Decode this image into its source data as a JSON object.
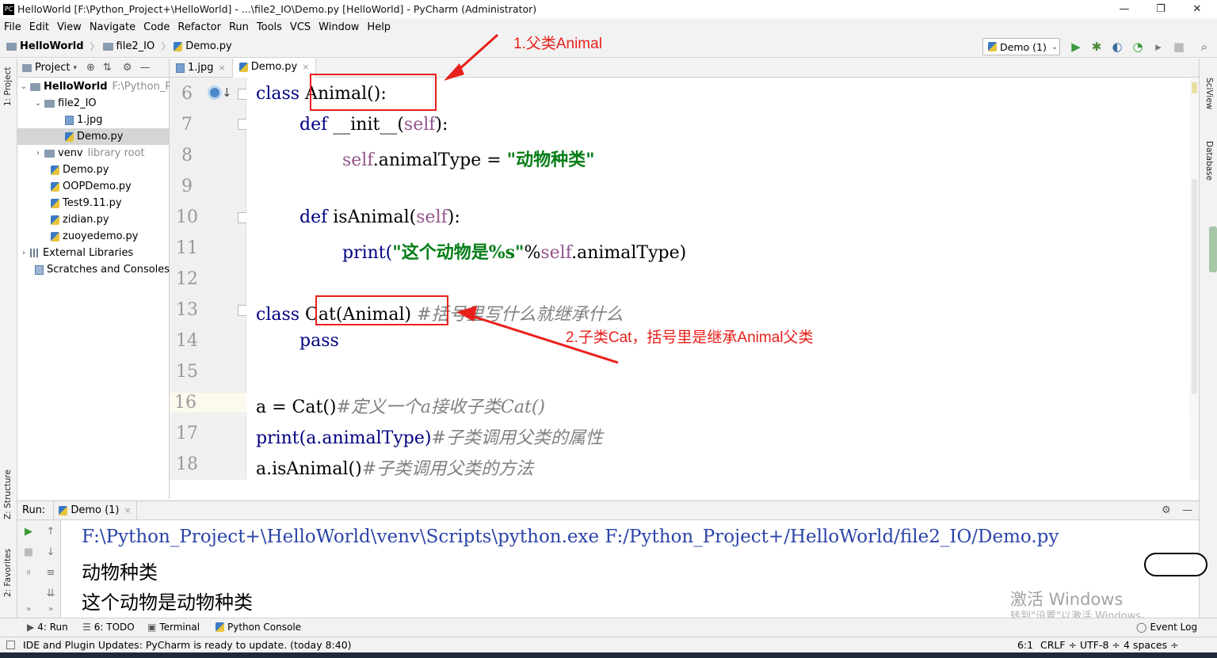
{
  "window": {
    "title": "HelloWorld [F:\\Python_Project+\\HelloWorld] - ...\\file2_IO\\Demo.py [HelloWorld] - PyCharm (Administrator)",
    "minimize": "—",
    "maximize": "❐",
    "close": "✕"
  },
  "menu": [
    "File",
    "Edit",
    "View",
    "Navigate",
    "Code",
    "Refactor",
    "Run",
    "Tools",
    "VCS",
    "Window",
    "Help"
  ],
  "breadcrumb": {
    "project": "HelloWorld",
    "folder": "file2_IO",
    "file": "Demo.py"
  },
  "run_config": {
    "label": "Demo (1)"
  },
  "left_strip": {
    "project": "1: Project",
    "structure": "Z: Structure",
    "favorites": "2: Favorites"
  },
  "right_strip": {
    "sciview": "SciView",
    "database": "Database"
  },
  "project_panel": {
    "header": "Project",
    "items": [
      {
        "label": "HelloWorld",
        "extra": "F:\\Python_Pro"
      },
      {
        "label": "file2_IO"
      },
      {
        "label": "1.jpg"
      },
      {
        "label": "Demo.py"
      },
      {
        "label": "venv",
        "extra": "library root"
      },
      {
        "label": "Demo.py"
      },
      {
        "label": "OOPDemo.py"
      },
      {
        "label": "Test9.11.py"
      },
      {
        "label": "zidian.py"
      },
      {
        "label": "zuoyedemo.py"
      },
      {
        "label": "External Libraries"
      },
      {
        "label": "Scratches and Consoles"
      }
    ]
  },
  "editor_tabs": [
    {
      "label": "1.jpg"
    },
    {
      "label": "Demo.py"
    }
  ],
  "code": {
    "line_numbers": [
      "6",
      "7",
      "8",
      "9",
      "10",
      "11",
      "12",
      "13",
      "14",
      "15",
      "16",
      "17",
      "18"
    ],
    "l6": {
      "kw": "class",
      "rest": " Animal():"
    },
    "l7": {
      "kw": "def",
      "name": " __init__(",
      "self": "self",
      "end": "):"
    },
    "l8": {
      "self": "self",
      "mid": ".animalType = ",
      "str": "\"动物种类\""
    },
    "l10": {
      "kw": "def",
      "name": " isAnimal(",
      "self": "self",
      "end": "):"
    },
    "l11": {
      "fn": "print(",
      "str": "\"这个动物是%s\"",
      "mid": "%",
      "self": "self",
      "end": ".animalType)"
    },
    "l13": {
      "kw": "class",
      "rest": " Cat(Animal)",
      "cm": " #括号里写什么就继承什么"
    },
    "l14": {
      "kw": "pass"
    },
    "l16": {
      "code": "a = Cat()",
      "cm": "#定义一个a接收子类Cat()"
    },
    "l17": {
      "code": "print(a.animalType)",
      "cm": "#子类调用父类的属性"
    },
    "l18": {
      "code": "a.isAnimal()",
      "cm": "#子类调用父类的方法"
    }
  },
  "annotations": {
    "a1": "1.父类Animal",
    "a2": "2.子类Cat，括号里是继承Animal父类"
  },
  "run_panel": {
    "label": "Run:",
    "tab": "Demo (1)"
  },
  "console": [
    "F:\\Python_Project+\\HelloWorld\\venv\\Scripts\\python.exe F:/Python_Project+/HelloWorld/file2_IO/Demo.py",
    "动物种类",
    "这个动物是动物种类"
  ],
  "bottom_tabs": {
    "run": "4: Run",
    "todo": "6: TODO",
    "terminal": "Terminal",
    "python_console": "Python Console",
    "event_log": "Event Log"
  },
  "status": {
    "message": "IDE and Plugin Updates: PyCharm is ready to update. (today 8:40)",
    "position": "6:1",
    "line_sep": "CRLF ÷",
    "encoding": "UTF-8 ÷",
    "indent": "4 spaces ÷"
  },
  "watermark": {
    "line1": "激活 Windows",
    "line2": "转到\"设置\"以激活 Windows。"
  },
  "colors": {
    "annotation": "#e8201b",
    "keyword": "#000080",
    "string": "#067d17",
    "self": "#94558d",
    "comment": "#808080"
  }
}
